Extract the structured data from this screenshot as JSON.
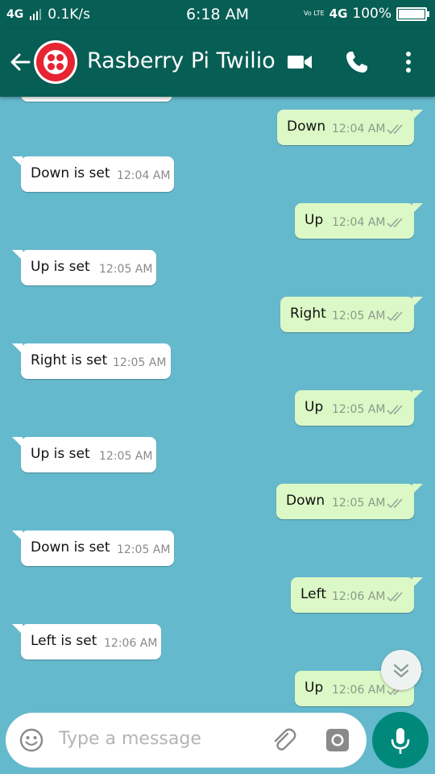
{
  "status_bar": {
    "network": "4G",
    "speed": "0.1K/s",
    "time": "6:18 AM",
    "volte": "Vo LTE",
    "network2": "4G",
    "battery": "100%"
  },
  "header": {
    "title": "Rasberry Pi Twilio",
    "icons": [
      "back-arrow-icon",
      "twilio-logo-avatar",
      "video-call-icon",
      "phone-icon",
      "more-vert-icon"
    ]
  },
  "messages": [
    {
      "dir": "out",
      "text": "Down",
      "time": "12:04 AM"
    },
    {
      "dir": "in",
      "text": "Down is set",
      "time": "12:04 AM"
    },
    {
      "dir": "out",
      "text": "Up",
      "time": "12:04 AM"
    },
    {
      "dir": "in",
      "text": "Up is set",
      "time": "12:05 AM"
    },
    {
      "dir": "out",
      "text": "Right",
      "time": "12:05 AM"
    },
    {
      "dir": "in",
      "text": "Right is set",
      "time": "12:05 AM"
    },
    {
      "dir": "out",
      "text": "Up",
      "time": "12:05 AM"
    },
    {
      "dir": "in",
      "text": "Up is set",
      "time": "12:05 AM"
    },
    {
      "dir": "out",
      "text": "Down",
      "time": "12:05 AM"
    },
    {
      "dir": "in",
      "text": "Down is set",
      "time": "12:05 AM"
    },
    {
      "dir": "out",
      "text": "Left",
      "time": "12:06 AM"
    },
    {
      "dir": "in",
      "text": "Left is set",
      "time": "12:06 AM"
    },
    {
      "dir": "out",
      "text": "Up",
      "time": "12:06 AM"
    }
  ],
  "composer": {
    "placeholder": "Type a message",
    "icons": [
      "emoji-icon",
      "attach-icon",
      "camera-icon",
      "mic-icon"
    ]
  },
  "colors": {
    "header": "#075e54",
    "chat_background": "#65b9cc",
    "outgoing_bubble": "#dcf8c6",
    "incoming_bubble": "#ffffff",
    "mic_button": "#00897b",
    "twilio_red": "#e62432"
  }
}
